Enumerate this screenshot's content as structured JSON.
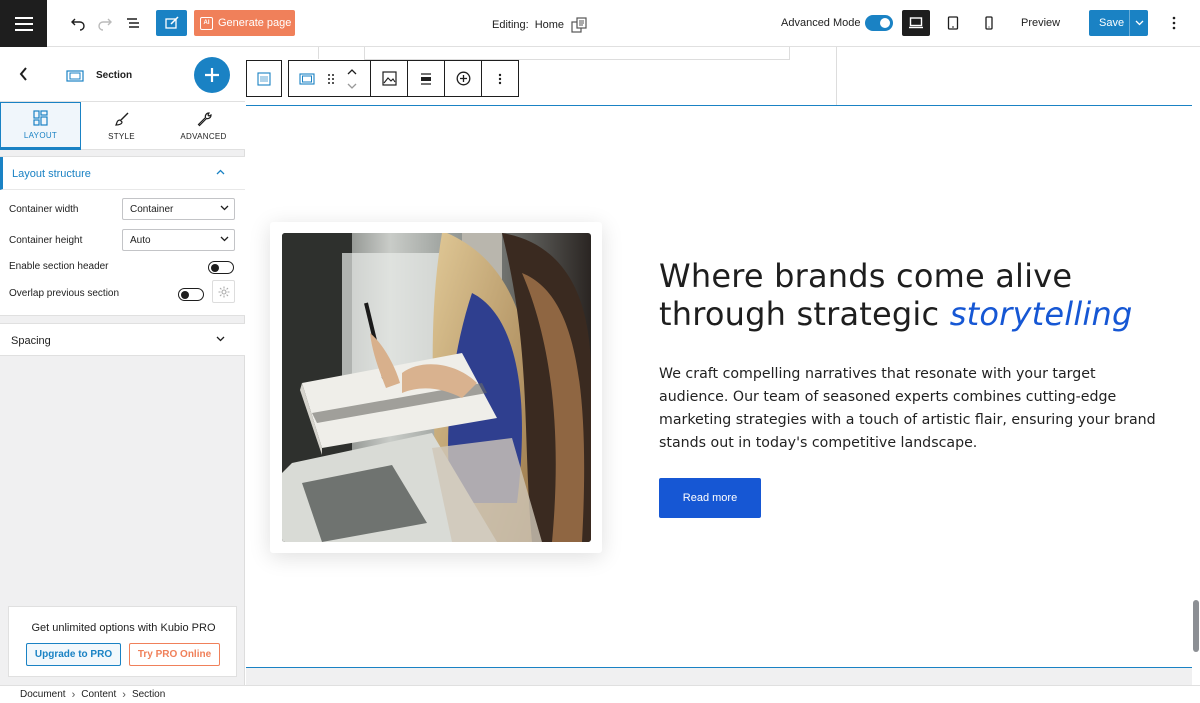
{
  "topbar": {
    "generate_label": "Generate page",
    "generate_ai": "AI",
    "editing_label": "Editing:",
    "editing_page": "Home",
    "advanced_mode_label": "Advanced Mode",
    "advanced_mode_on": true,
    "preview_label": "Preview",
    "save_label": "Save",
    "device_active": "desktop"
  },
  "sidebar": {
    "title": "Section",
    "tabs": [
      {
        "label": "LAYOUT",
        "icon": "layout-icon",
        "active": true
      },
      {
        "label": "STYLE",
        "icon": "brush-icon",
        "active": false
      },
      {
        "label": "ADVANCED",
        "icon": "wrench-icon",
        "active": false
      }
    ],
    "layout_panel": {
      "title": "Layout structure",
      "container_width_label": "Container width",
      "container_width_value": "Container",
      "container_height_label": "Container height",
      "container_height_value": "Auto",
      "section_header_label": "Enable section header",
      "section_header_on": false,
      "overlap_label": "Overlap previous section",
      "overlap_on": false
    },
    "spacing_panel": {
      "title": "Spacing"
    },
    "pro": {
      "text": "Get unlimited options with Kubio PRO",
      "upgrade_label": "Upgrade to PRO",
      "try_label": "Try PRO Online"
    }
  },
  "breadcrumb": [
    "Document",
    "Content",
    "Section"
  ],
  "content": {
    "headline_main": "Where brands come alive through strategic ",
    "headline_emph": "storytelling",
    "body": "We craft compelling narratives that resonate with your target audience. Our team of seasoned experts combines cutting-edge marketing strategies with a touch of artistic flair, ensuring your brand stands out in today's competitive landscape.",
    "button_label": "Read more"
  },
  "colors": {
    "accent": "#1a82c4",
    "brand_blue": "#1657d4",
    "generate_orange": "#f0805a",
    "dark": "#1e1e1e"
  }
}
